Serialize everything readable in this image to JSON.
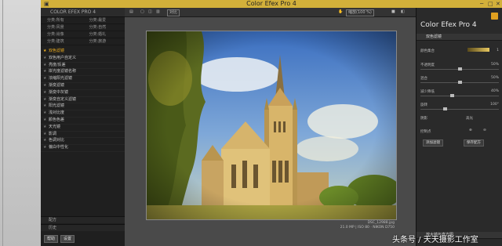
{
  "window": {
    "title": "Color Efex Pro 4"
  },
  "left_panel": {
    "header": "COLOR EFEX PRO 4",
    "categories": [
      "分类:所有",
      "分类:最爱",
      "分类:风景",
      "分类:自然",
      "分类:肖像",
      "分类:婚礼",
      "分类:建筑",
      "分类:旅游"
    ],
    "filters": [
      {
        "label": "双色滤镜",
        "selected": true
      },
      {
        "label": "双色用户自定义",
        "selected": false
      },
      {
        "label": "亮度/反差",
        "selected": false
      },
      {
        "label": "岸光度滤镜名称",
        "selected": false
      },
      {
        "label": "浓缩阳光滤镜",
        "selected": false
      },
      {
        "label": "渐变滤镜",
        "selected": false
      },
      {
        "label": "渐变中灰镜",
        "selected": false
      },
      {
        "label": "渐变自定义滤镜",
        "selected": false
      },
      {
        "label": "阳光滤镜",
        "selected": false
      },
      {
        "label": "浅对比度",
        "selected": false
      },
      {
        "label": "颜色色差",
        "selected": false
      },
      {
        "label": "天光镜",
        "selected": false
      },
      {
        "label": "影调",
        "selected": false
      },
      {
        "label": "色调对比",
        "selected": false
      },
      {
        "label": "偏白中性化",
        "selected": false
      }
    ],
    "bottom_section_1": "配方",
    "bottom_section_2": "历史",
    "help_button": "帮助",
    "settings_button": "设置"
  },
  "toolbar": {
    "compare_label": "对比",
    "zoom_label": "缩放(100 %)",
    "icons": [
      "panel-toggle-icon",
      "single-view-icon",
      "split-view-icon",
      "side-by-side-icon"
    ]
  },
  "image": {
    "filename": "DSC_12988.jpg",
    "info": "21.0 MP | ISO 80 · NIKON D750"
  },
  "right_panel": {
    "brand": "Color Efex Pro 4",
    "section_title": "双色滤镜",
    "color_set_label": "颜色集合",
    "color_set_value": "1",
    "sliders": [
      {
        "label": "不透明度",
        "value": "50%",
        "fraction": 0.5
      },
      {
        "label": "混合",
        "value": "50%",
        "fraction": 0.5
      },
      {
        "label": "减少降低",
        "value": "40%",
        "fraction": 0.4
      },
      {
        "label": "旋转",
        "value": "100°",
        "fraction": 0.3
      }
    ],
    "shadows_label": "阴影",
    "highlights_label": "高光",
    "control_points_label": "控制点",
    "add_filter_button": "添加滤镜",
    "save_recipe_button": "保存配方",
    "bottom_section": "放大镜与直方图"
  },
  "watermark": "头条号 / 天天摄影工作室",
  "colors": {
    "accent": "#f0b020",
    "titlebar": "#d2b03a"
  }
}
